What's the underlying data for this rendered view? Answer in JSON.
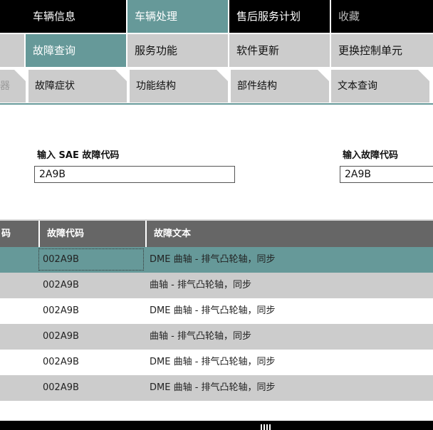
{
  "nav1": [
    "车辆信息",
    "车辆处理",
    "售后服务计划",
    "收藏"
  ],
  "nav2": [
    "故障查询",
    "服务功能",
    "软件更新",
    "更换控制单元"
  ],
  "nav3": [
    "器",
    "故障症状",
    "功能结构",
    "部件结构",
    "文本查询"
  ],
  "form": {
    "sae_label_prefix": "输入",
    "sae_label_bold": "SAE",
    "sae_label_suffix": "故障代码",
    "sae_value": "2A9B",
    "code_label": "输入故障代码",
    "code_value": "2A9B"
  },
  "table": {
    "headers": [
      "码",
      "故障代码",
      "故障文本"
    ],
    "rows": [
      {
        "code": "002A9B",
        "text": "DME 曲轴 - 排气凸轮轴，同步"
      },
      {
        "code": "002A9B",
        "text": "曲轴 - 排气凸轮轴，同步"
      },
      {
        "code": "002A9B",
        "text": "DME 曲轴 - 排气凸轮轴，同步"
      },
      {
        "code": "002A9B",
        "text": "曲轴 - 排气凸轮轴，同步"
      },
      {
        "code": "002A9B",
        "text": "DME 曲轴 - 排气凸轮轴，同步"
      },
      {
        "code": "002A9B",
        "text": "DME 曲轴 - 排气凸轮轴，同步"
      }
    ]
  },
  "colors": {
    "accent": "#669999",
    "header": "#666666",
    "tab": "#cccccc"
  }
}
